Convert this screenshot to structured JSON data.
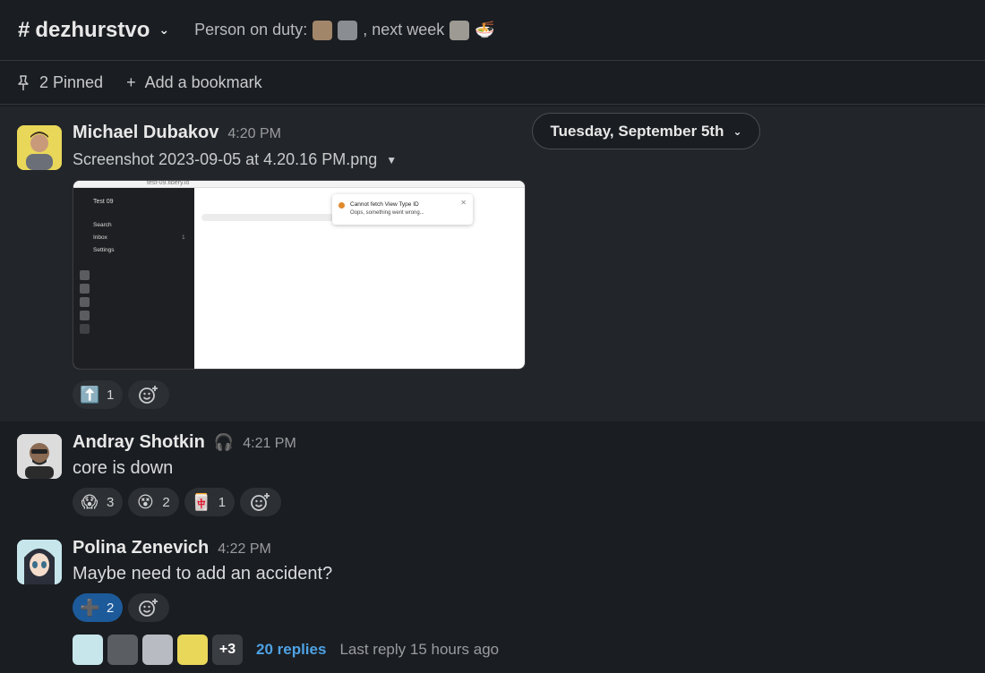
{
  "header": {
    "channel_hash": "#",
    "channel_name": "dezhurstvo",
    "topic_prefix": "Person on duty:",
    "topic_middle": ", next week"
  },
  "bookmarks": {
    "pinned_label": "2 Pinned",
    "add_label": "Add a bookmark"
  },
  "date_divider": "Tuesday, September 5th",
  "messages": [
    {
      "author": "Michael Dubakov",
      "time": "4:20 PM",
      "file_name": "Screenshot 2023-09-05 at 4.20.16 PM.png",
      "screenshot": {
        "url": "test-09.fibery.io",
        "workspace": "Test 09",
        "nav": [
          "Search",
          "Inbox",
          "Settings"
        ],
        "inbox_count": "1",
        "toast_title": "Cannot fetch View Type ID",
        "toast_body": "Oops, something went wrong..."
      },
      "reactions": [
        {
          "emoji": "⬆️",
          "count": "1"
        }
      ]
    },
    {
      "author": "Andray Shotkin",
      "status_emoji": "🎧",
      "time": "4:21 PM",
      "text": "core is down",
      "reactions": [
        {
          "emoji": "😱",
          "count": "3"
        },
        {
          "emoji": "😵",
          "count": "2"
        },
        {
          "emoji": "🀄",
          "count": "1"
        }
      ]
    },
    {
      "author": "Polina Zenevich",
      "time": "4:22 PM",
      "text": "Maybe need to add an accident?",
      "reactions": [
        {
          "emoji": "➕",
          "count": "2"
        }
      ],
      "thread": {
        "more": "+3",
        "replies": "20 replies",
        "last_reply": "Last reply 15 hours ago"
      }
    }
  ]
}
